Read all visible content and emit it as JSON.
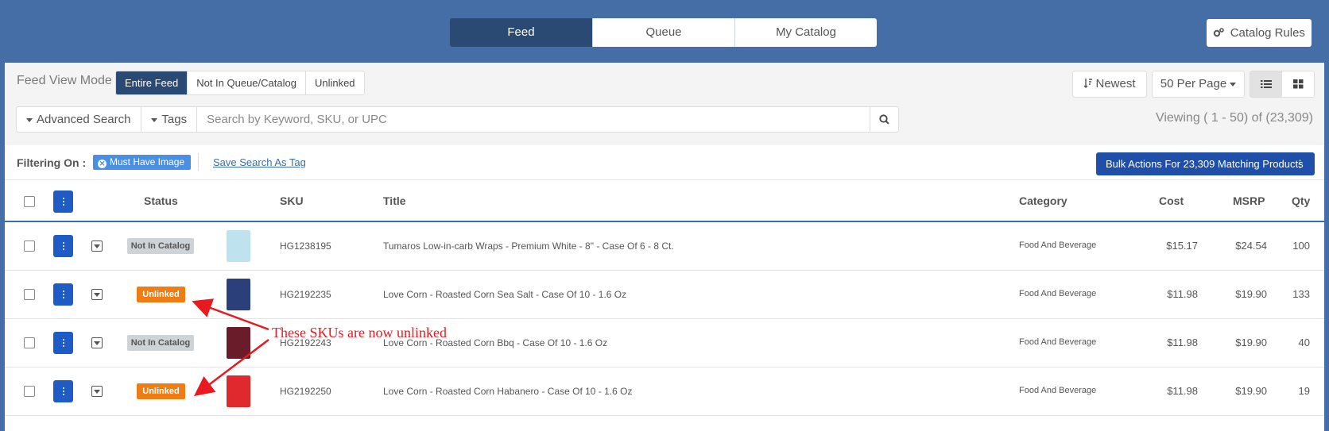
{
  "nav": {
    "tabs": [
      {
        "label": "Feed",
        "active": true
      },
      {
        "label": "Queue",
        "active": false
      },
      {
        "label": "My Catalog",
        "active": false
      }
    ],
    "catalog_rules_label": "Catalog Rules"
  },
  "toolbar": {
    "view_mode_label": "Feed View Mode",
    "view_modes": [
      {
        "label": "Entire Feed",
        "active": true
      },
      {
        "label": "Not In Queue/Catalog",
        "active": false
      },
      {
        "label": "Unlinked",
        "active": false
      }
    ],
    "sort_label": "Newest",
    "per_page_label": "50 Per Page",
    "view_toggle_active": "list"
  },
  "search": {
    "advanced_label": "Advanced Search",
    "tags_label": "Tags",
    "placeholder": "Search by Keyword, SKU, or UPC",
    "value": "",
    "viewing_text": "Viewing ( 1 - 50) of (23,309)"
  },
  "filters": {
    "label": "Filtering On :",
    "chips": [
      "Must Have Image"
    ],
    "save_link": "Save Search As Tag",
    "bulk_label": "Bulk Actions For 23,309 Matching Products"
  },
  "table": {
    "headers": {
      "status": "Status",
      "sku": "SKU",
      "title": "Title",
      "category": "Category",
      "cost": "Cost",
      "msrp": "MSRP",
      "qty": "Qty"
    },
    "rows": [
      {
        "status": "Not In Catalog",
        "status_type": "not-in-catalog",
        "thumb_color": "#bfe3ee",
        "sku": "HG1238195",
        "title": "Tumaros Low-in-carb Wraps - Premium White - 8\" - Case Of 6 - 8 Ct.",
        "category": "Food And Beverage",
        "cost": "$15.17",
        "msrp": "$24.54",
        "qty": "100"
      },
      {
        "status": "Unlinked",
        "status_type": "unlinked",
        "thumb_color": "#2b3f7a",
        "sku": "HG2192235",
        "title": "Love Corn - Roasted Corn Sea Salt - Case Of 10 - 1.6 Oz",
        "category": "Food And Beverage",
        "cost": "$11.98",
        "msrp": "$19.90",
        "qty": "133"
      },
      {
        "status": "Not In Catalog",
        "status_type": "not-in-catalog",
        "thumb_color": "#6b1c2a",
        "sku": "HG2192243",
        "title": "Love Corn - Roasted Corn Bbq - Case Of 10 - 1.6 Oz",
        "category": "Food And Beverage",
        "cost": "$11.98",
        "msrp": "$19.90",
        "qty": "40"
      },
      {
        "status": "Unlinked",
        "status_type": "unlinked",
        "thumb_color": "#e0292e",
        "sku": "HG2192250",
        "title": "Love Corn - Roasted Corn Habanero - Case Of 10 - 1.6 Oz",
        "category": "Food And Beverage",
        "cost": "$11.98",
        "msrp": "$19.90",
        "qty": "19"
      }
    ]
  },
  "annotation": {
    "text": "These SKUs are now unlinked",
    "color": "#e8191f"
  },
  "colors": {
    "header_blue": "#456ea6",
    "active_dark": "#2a4a73",
    "primary_blue": "#1f5bc4",
    "unlinked_orange": "#f07d13",
    "not_in_catalog_gray": "#ced3d8"
  }
}
